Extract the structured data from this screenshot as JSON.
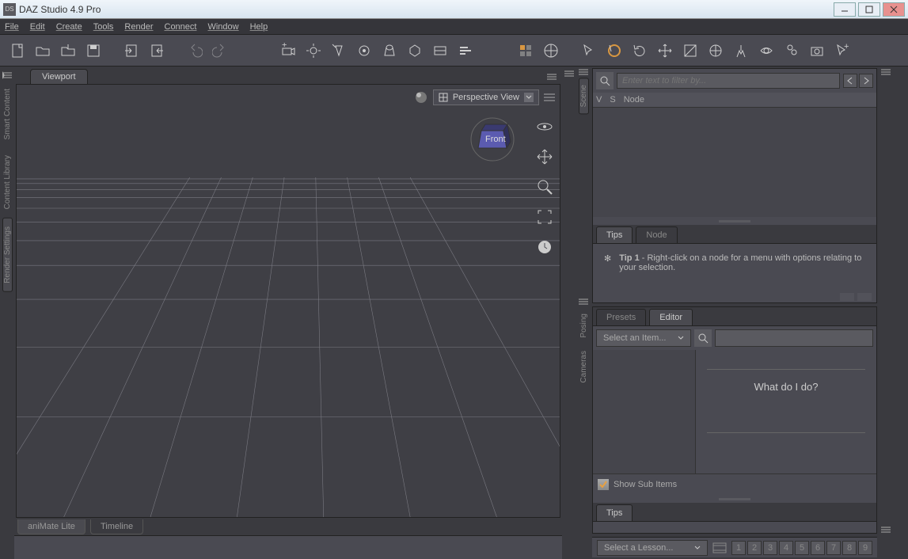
{
  "window": {
    "title": "DAZ Studio 4.9 Pro",
    "logo": "DS"
  },
  "menu": {
    "items": [
      "File",
      "Edit",
      "Create",
      "Tools",
      "Render",
      "Connect",
      "Window",
      "Help"
    ]
  },
  "left_tabs": [
    "Smart Content",
    "Content Library",
    "Render Settings"
  ],
  "viewport": {
    "tab_label": "Viewport",
    "view_selector": "Perspective View",
    "navcube_face": "Front"
  },
  "bottom_tabs": [
    "aniMate Lite",
    "Timeline"
  ],
  "scene": {
    "filter_placeholder": "Enter text to filter by...",
    "columns": {
      "v": "V",
      "s": "S",
      "node": "Node"
    },
    "tip_tab": "Tips",
    "node_tab": "Node",
    "tip_label": "Tip 1",
    "tip_text": " - Right-click on a node for a menu with options relating to your selection."
  },
  "right_tabs": [
    "Scene",
    "Posing",
    "Cameras"
  ],
  "surfaces": {
    "presets_tab": "Presets",
    "editor_tab": "Editor",
    "select_item": "Select an Item...",
    "what_do": "What do I do?",
    "show_sub": "Show Sub Items",
    "tips_tab": "Tips"
  },
  "lesson": {
    "select": "Select a Lesson...",
    "numbers": [
      "1",
      "2",
      "3",
      "4",
      "5",
      "6",
      "7",
      "8",
      "9"
    ]
  }
}
